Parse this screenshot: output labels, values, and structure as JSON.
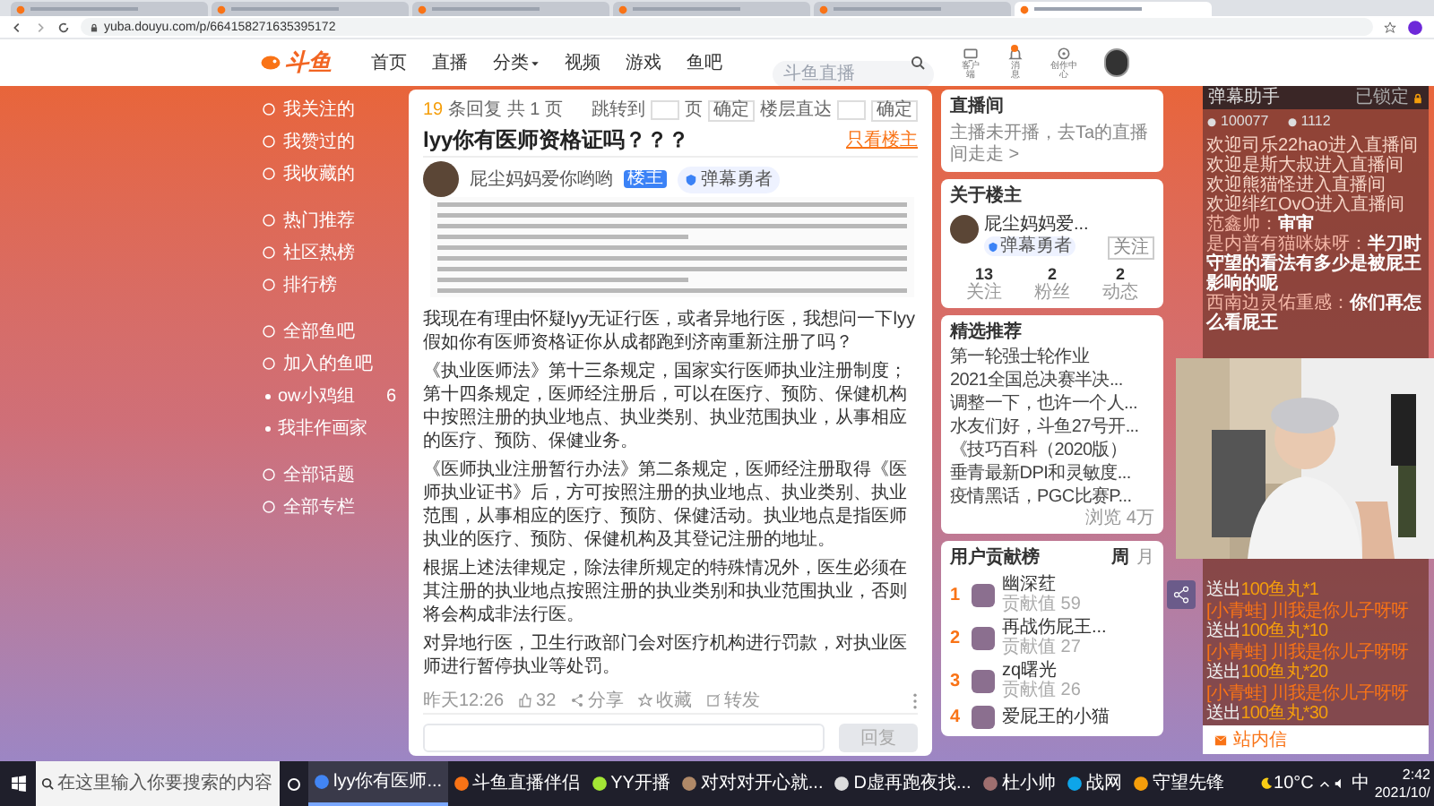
{
  "browser": {
    "tabs": [
      {
        "selected": false
      },
      {
        "selected": false
      },
      {
        "selected": false
      },
      {
        "selected": false
      },
      {
        "selected": false
      },
      {
        "selected": true
      }
    ],
    "url": "yuba.douyu.com/p/664158271635395172"
  },
  "header": {
    "logo": "斗鱼",
    "nav": [
      "首页",
      "直播",
      "分类",
      "视频",
      "游戏",
      "鱼吧"
    ],
    "search_placeholder": "斗鱼直播",
    "actions": [
      "客户端",
      "消息",
      "创作中心"
    ],
    "message_badge": true
  },
  "sidebar": {
    "sections": [
      {
        "items": [
          {
            "label": "我关注的",
            "kind": "link"
          },
          {
            "label": "我赞过的",
            "kind": "link"
          },
          {
            "label": "我收藏的",
            "kind": "link"
          }
        ]
      },
      {
        "items": [
          {
            "label": "热门推荐",
            "kind": "link"
          },
          {
            "label": "社区热榜",
            "kind": "link"
          },
          {
            "label": "排行榜",
            "kind": "link"
          }
        ]
      },
      {
        "items": [
          {
            "label": "全部鱼吧",
            "kind": "link"
          },
          {
            "label": "加入的鱼吧",
            "kind": "link"
          },
          {
            "label": "ow小鸡组",
            "kind": "group",
            "count": "6"
          },
          {
            "label": "我非作画家",
            "kind": "group"
          }
        ]
      },
      {
        "items": [
          {
            "label": "全部话题",
            "kind": "link"
          },
          {
            "label": "全部专栏",
            "kind": "link"
          }
        ]
      }
    ]
  },
  "post": {
    "reply_count": "19",
    "reply_text": "条回复 共 1 页",
    "jump_label": "跳转到",
    "page_unit": "页",
    "confirm": "确定",
    "floor_label": "楼层直达",
    "floor_confirm": "确定",
    "title": "lyy你有医师资格证吗？？？",
    "only_author": "只看楼主",
    "author": {
      "name": "屁尘妈妈爱你哟哟",
      "tag": "楼主",
      "badge": "弹幕勇者"
    },
    "image": {
      "kind": "picture"
    },
    "paragraphs": [
      "我现在有理由怀疑lyy无证行医，或者异地行医，我想问一下lyy假如你有医师资格证你从成都跑到济南重新注册了吗？",
      "《执业医师法》第十三条规定，国家实行医师执业注册制度；第十四条规定，医师经注册后，可以在医疗、预防、保健机构中按照注册的执业地点、执业类别、执业范围执业，从事相应的医疗、预防、保健业务。",
      "《医师执业注册暂行办法》第二条规定，医师经注册取得《医师执业证书》后，方可按照注册的执业地点、执业类别、执业范围，从事相应的医疗、预防、保健活动。执业地点是指医师执业的医疗、预防、保健机构及其登记注册的地址。",
      "根据上述法律规定，除法律所规定的特殊情况外，医生必须在其注册的执业地点按照注册的执业类别和执业范围执业，否则将会构成非法行医。",
      "对异地行医，卫生行政部门会对医疗机构进行罚款，对执业医师进行暂停执业等处罚。"
    ],
    "time": "昨天12:26",
    "likes": "32",
    "share": "分享",
    "favorite": "收藏",
    "forward": "转发",
    "reply_button": {
      "label": "回复",
      "disabled": true
    }
  },
  "live_room": {
    "title": "直播间",
    "text": "主播未开播，去Ta的直播间走走 >"
  },
  "about": {
    "title": "关于楼主",
    "name": "屁尘妈妈爱...",
    "badge": "弹幕勇者",
    "follow": "关注",
    "stats": [
      {
        "value": "13",
        "label": "关注"
      },
      {
        "value": "2",
        "label": "粉丝"
      },
      {
        "value": "2",
        "label": "动态"
      }
    ]
  },
  "recommend": {
    "title": "精选推荐",
    "items": [
      "第一轮强士轮作业",
      "2021全国总决赛半决...",
      "调整一下，也许一个人...",
      "水友们好，斗鱼27号开...",
      "《技巧百科（2020版）",
      "垂青最新DPI和灵敏度...",
      "疫情黑话，PGC比赛P..."
    ],
    "views": "浏览 4万"
  },
  "ranking": {
    "title": "用户贡献榜",
    "tabs": [
      {
        "label": "周",
        "selected": true
      },
      {
        "label": "月",
        "selected": false
      }
    ],
    "rows": [
      {
        "rank": "1",
        "name": "幽深荭",
        "score": "贡献值 59"
      },
      {
        "rank": "2",
        "name": "再战伤屁王...",
        "score": "贡献值 27"
      },
      {
        "rank": "3",
        "name": "zq曙光",
        "score": "贡献值 26"
      },
      {
        "rank": "4",
        "name": "爱屁王的小猫"
      }
    ]
  },
  "danmu": {
    "title": "弹幕助手",
    "lock": "已锁定",
    "stats": [
      "100077",
      "1112"
    ],
    "messages": [
      {
        "kind": "welcome",
        "text": "欢迎司乐22hao进入直播间"
      },
      {
        "kind": "welcome",
        "text": "欢迎是斯大叔进入直播间"
      },
      {
        "kind": "welcome",
        "text": "欢迎熊猫怪进入直播间"
      },
      {
        "kind": "welcome",
        "text": "欢迎绯红OvO进入直播间"
      },
      {
        "kind": "chat",
        "user": "范鑫帅：",
        "text": "审审"
      },
      {
        "kind": "chat",
        "user": "是内普有猫咪妹呀：",
        "text": "半刀时守望的看法有多少是被屁王影响的呢"
      },
      {
        "kind": "chat",
        "user": "西南边灵佑重感：",
        "text": "你们再怎么看屁王"
      }
    ],
    "gifts": [
      {
        "text": "送出100鱼丸*1"
      },
      {
        "user": "[小青蛙] 川我是你儿子呀呀",
        "text": "送出100鱼丸*10"
      },
      {
        "user": "[小青蛙] 川我是你儿子呀呀",
        "text": "送出100鱼丸*20"
      },
      {
        "user": "[小青蛙] 川我是你儿子呀呀",
        "text": "送出100鱼丸*30"
      }
    ],
    "inbox": "站内信"
  },
  "camera": {
    "kind": "picture"
  },
  "taskbar": {
    "search_placeholder": "在这里输入你要搜索的内容",
    "tasks": [
      {
        "label": "lyy你有医师...",
        "selected": true
      },
      {
        "label": "斗鱼直播伴侣",
        "selected": false
      },
      {
        "label": "YY开播",
        "selected": false
      },
      {
        "label": "对对对开心就...",
        "selected": false
      },
      {
        "label": "D虚再跑夜找...",
        "selected": false
      },
      {
        "label": "杜小帅",
        "selected": false
      },
      {
        "label": "战网",
        "selected": false
      },
      {
        "label": "守望先锋",
        "selected": false
      }
    ],
    "weather": "10°C",
    "ime": "中",
    "time": "2:42",
    "date": "2021/10/"
  }
}
